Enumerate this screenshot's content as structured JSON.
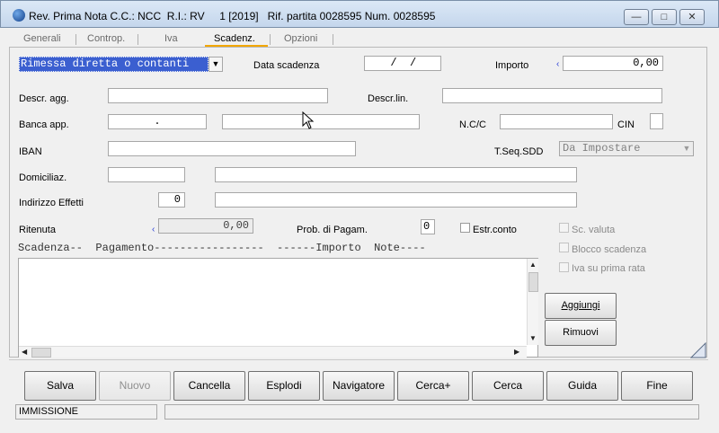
{
  "window": {
    "title": "Rev. Prima Nota C.C.: NCC  R.I.: RV     1 [2019]   Rif. partita 0028595 Num. 0028595",
    "min_glyph": "—",
    "max_glyph": "□",
    "close_glyph": "✕"
  },
  "tabs": [
    {
      "label": "Generali"
    },
    {
      "label": "Controp."
    },
    {
      "label": "Iva"
    },
    {
      "label": "Scadenz."
    },
    {
      "label": "Opzioni"
    }
  ],
  "active_tab": "Scadenz.",
  "form": {
    "tipo_pagamento": {
      "value": "Rimessa diretta o contanti"
    },
    "data_scadenza": {
      "label": "Data scadenza",
      "value": "  /  /"
    },
    "importo": {
      "label": "Importo",
      "value": "0,00"
    },
    "descr_agg": {
      "label": "Descr. agg.",
      "value": ""
    },
    "descr_lin": {
      "label": "Descr.lin.",
      "value": ""
    },
    "banca_app": {
      "label": "Banca app.",
      "abi_cab": ".",
      "desc": ""
    },
    "ncc": {
      "label": "N.C/C",
      "value": ""
    },
    "cin": {
      "label": "CIN",
      "value": ""
    },
    "iban": {
      "label": "IBAN",
      "value": ""
    },
    "tseq_sdd": {
      "label": "T.Seq.SDD",
      "value": "Da Impostare"
    },
    "domiciliaz": {
      "label": "Domiciliaz.",
      "code": "",
      "desc": ""
    },
    "indirizzo_effetti": {
      "label": "Indirizzo Effetti",
      "code": "0",
      "desc": ""
    },
    "ritenuta": {
      "label": "Ritenuta",
      "value": "0,00"
    },
    "prob_pagam": {
      "label": "Prob. di Pagam.",
      "value": "0"
    },
    "estr_conto": {
      "label": "Estr.conto"
    },
    "sc_valuta": {
      "label": "Sc. valuta"
    },
    "blocco_scadenza": {
      "label": "Blocco scadenza"
    },
    "iva_prima_rata": {
      "label": "Iva su prima rata"
    }
  },
  "list": {
    "header": "Scadenza--  Pagamento-----------------  ------Importo  Note----",
    "rows": []
  },
  "side_buttons": {
    "aggiungi": "Aggiungi",
    "rimuovi": "Rimuovi"
  },
  "buttons": {
    "salva": "Salva",
    "nuovo": "Nuovo",
    "cancella": "Cancella",
    "esplodi": "Esplodi",
    "navigatore": "Navigatore",
    "cerca_plus": "Cerca+",
    "cerca": "Cerca",
    "guida": "Guida",
    "fine": "Fine"
  },
  "status": {
    "mode": "IMMISSIONE",
    "message": ""
  },
  "colors": {
    "selection": "#3b5fd0",
    "tab_accent": "#f2a700"
  }
}
